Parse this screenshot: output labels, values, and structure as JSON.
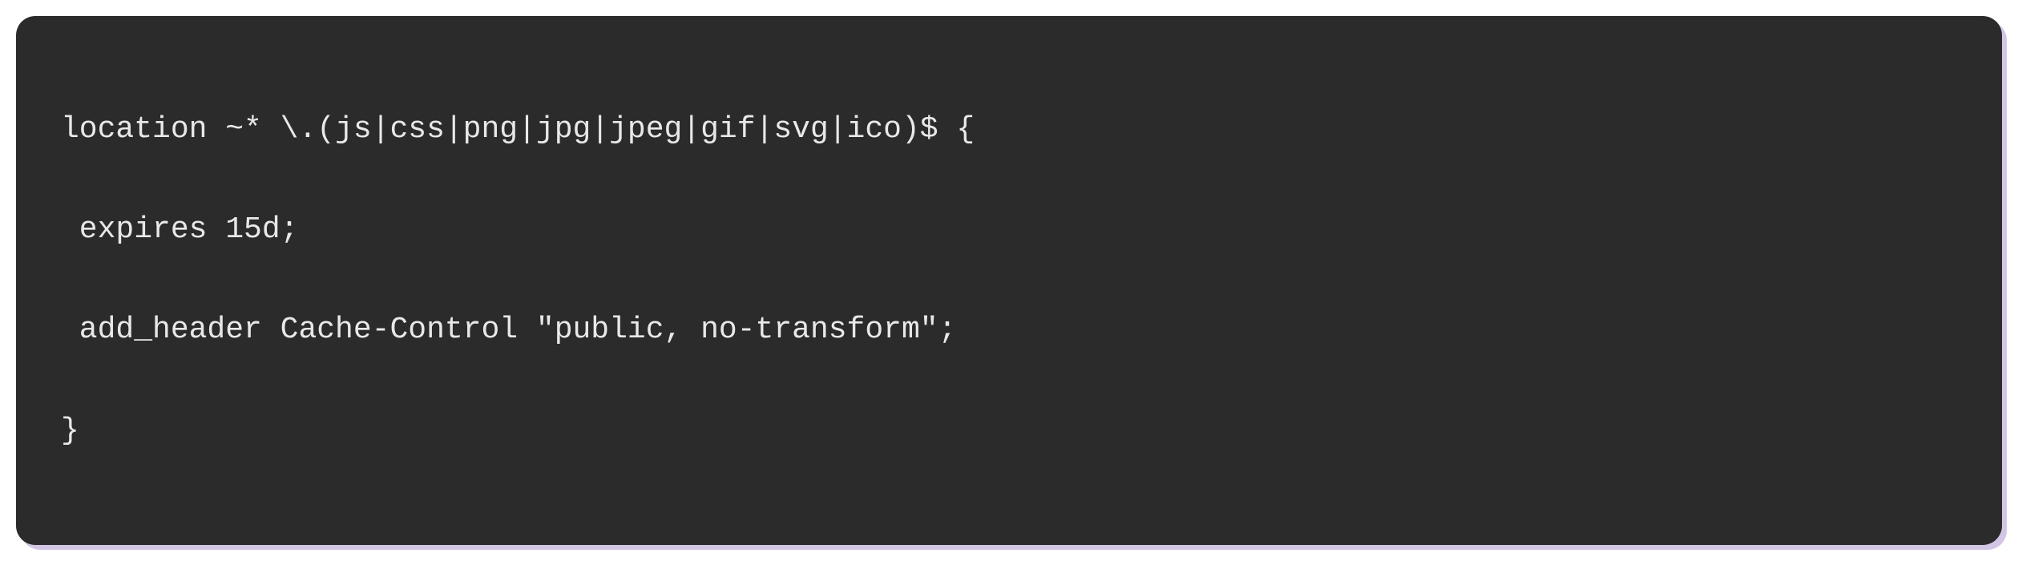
{
  "code": {
    "lines": [
      "location ~* \\.(js|css|png|jpg|jpeg|gif|svg|ico)$ {",
      " expires 15d;",
      " add_header Cache-Control \"public, no-transform\";",
      "}"
    ]
  }
}
